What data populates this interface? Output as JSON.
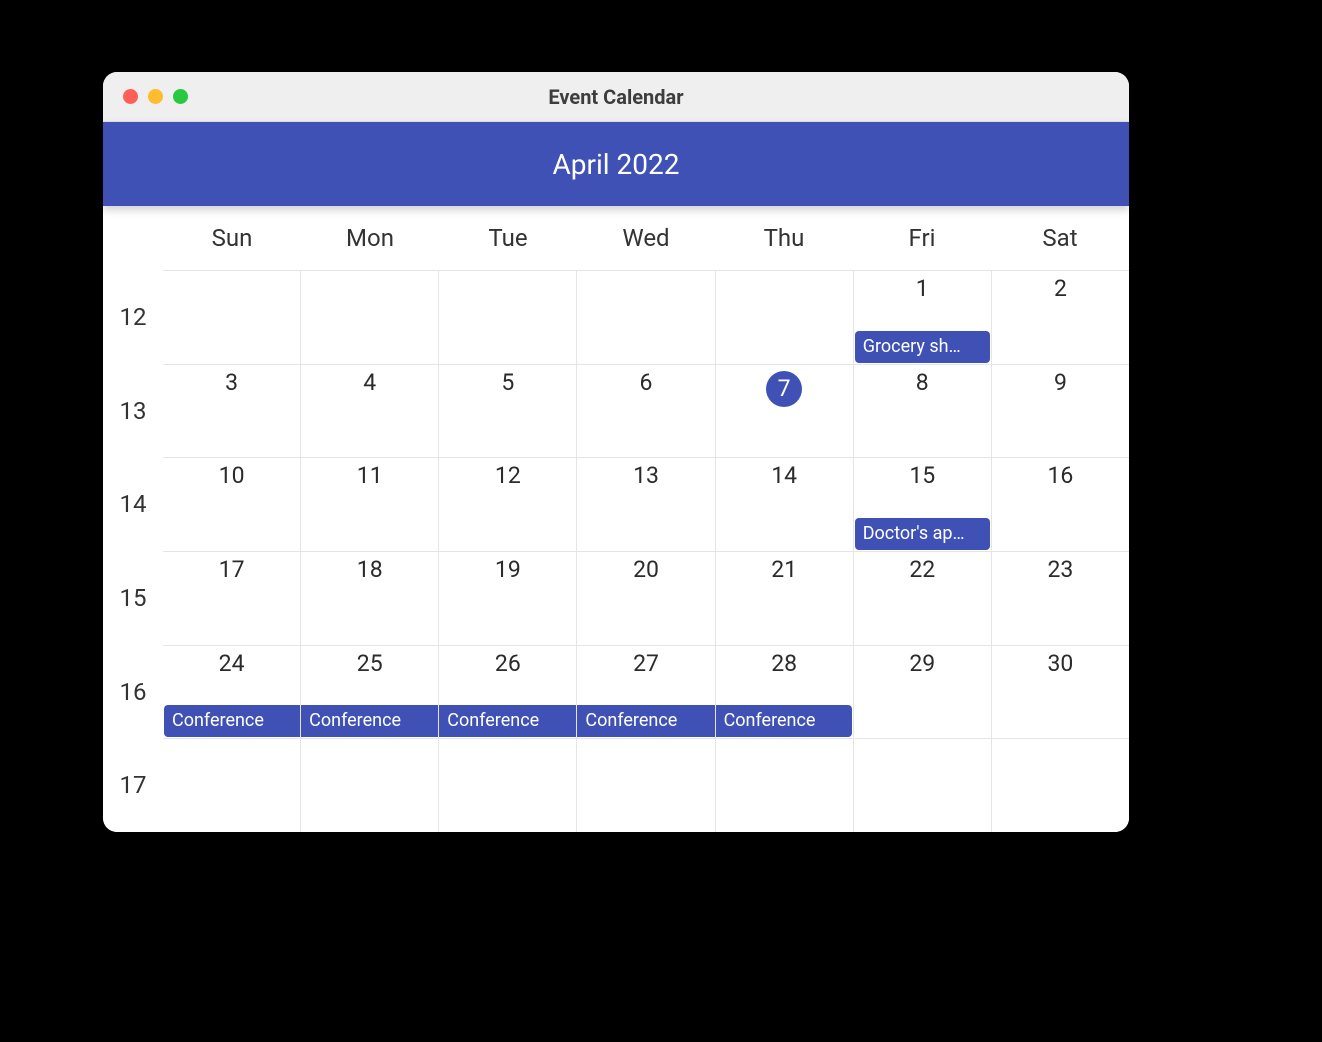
{
  "window": {
    "title": "Event Calendar"
  },
  "header": {
    "month_label": "April 2022"
  },
  "days_of_week": [
    "Sun",
    "Mon",
    "Tue",
    "Wed",
    "Thu",
    "Fri",
    "Sat"
  ],
  "week_numbers": [
    "12",
    "13",
    "14",
    "15",
    "16",
    "17"
  ],
  "today_day": "7",
  "weeks": [
    {
      "days": [
        {
          "num": "",
          "events": []
        },
        {
          "num": "",
          "events": []
        },
        {
          "num": "",
          "events": []
        },
        {
          "num": "",
          "events": []
        },
        {
          "num": "",
          "events": []
        },
        {
          "num": "1",
          "events": [
            {
              "label": "Grocery sh…"
            }
          ]
        },
        {
          "num": "2",
          "events": []
        }
      ]
    },
    {
      "days": [
        {
          "num": "3",
          "events": []
        },
        {
          "num": "4",
          "events": []
        },
        {
          "num": "5",
          "events": []
        },
        {
          "num": "6",
          "events": []
        },
        {
          "num": "7",
          "events": []
        },
        {
          "num": "8",
          "events": []
        },
        {
          "num": "9",
          "events": []
        }
      ]
    },
    {
      "days": [
        {
          "num": "10",
          "events": []
        },
        {
          "num": "11",
          "events": []
        },
        {
          "num": "12",
          "events": []
        },
        {
          "num": "13",
          "events": []
        },
        {
          "num": "14",
          "events": []
        },
        {
          "num": "15",
          "events": [
            {
              "label": "Doctor's ap…"
            }
          ]
        },
        {
          "num": "16",
          "events": []
        }
      ]
    },
    {
      "days": [
        {
          "num": "17",
          "events": []
        },
        {
          "num": "18",
          "events": []
        },
        {
          "num": "19",
          "events": []
        },
        {
          "num": "20",
          "events": []
        },
        {
          "num": "21",
          "events": []
        },
        {
          "num": "22",
          "events": []
        },
        {
          "num": "23",
          "events": []
        }
      ]
    },
    {
      "days": [
        {
          "num": "24",
          "events": [
            {
              "label": "Conference",
              "span": "start"
            }
          ]
        },
        {
          "num": "25",
          "events": [
            {
              "label": "Conference",
              "span": "mid"
            }
          ]
        },
        {
          "num": "26",
          "events": [
            {
              "label": "Conference",
              "span": "mid"
            }
          ]
        },
        {
          "num": "27",
          "events": [
            {
              "label": "Conference",
              "span": "mid"
            }
          ]
        },
        {
          "num": "28",
          "events": [
            {
              "label": "Conference",
              "span": "end"
            }
          ]
        },
        {
          "num": "29",
          "events": []
        },
        {
          "num": "30",
          "events": []
        }
      ]
    },
    {
      "days": [
        {
          "num": "",
          "events": []
        },
        {
          "num": "",
          "events": []
        },
        {
          "num": "",
          "events": []
        },
        {
          "num": "",
          "events": []
        },
        {
          "num": "",
          "events": []
        },
        {
          "num": "",
          "events": []
        },
        {
          "num": "",
          "events": []
        }
      ]
    }
  ]
}
